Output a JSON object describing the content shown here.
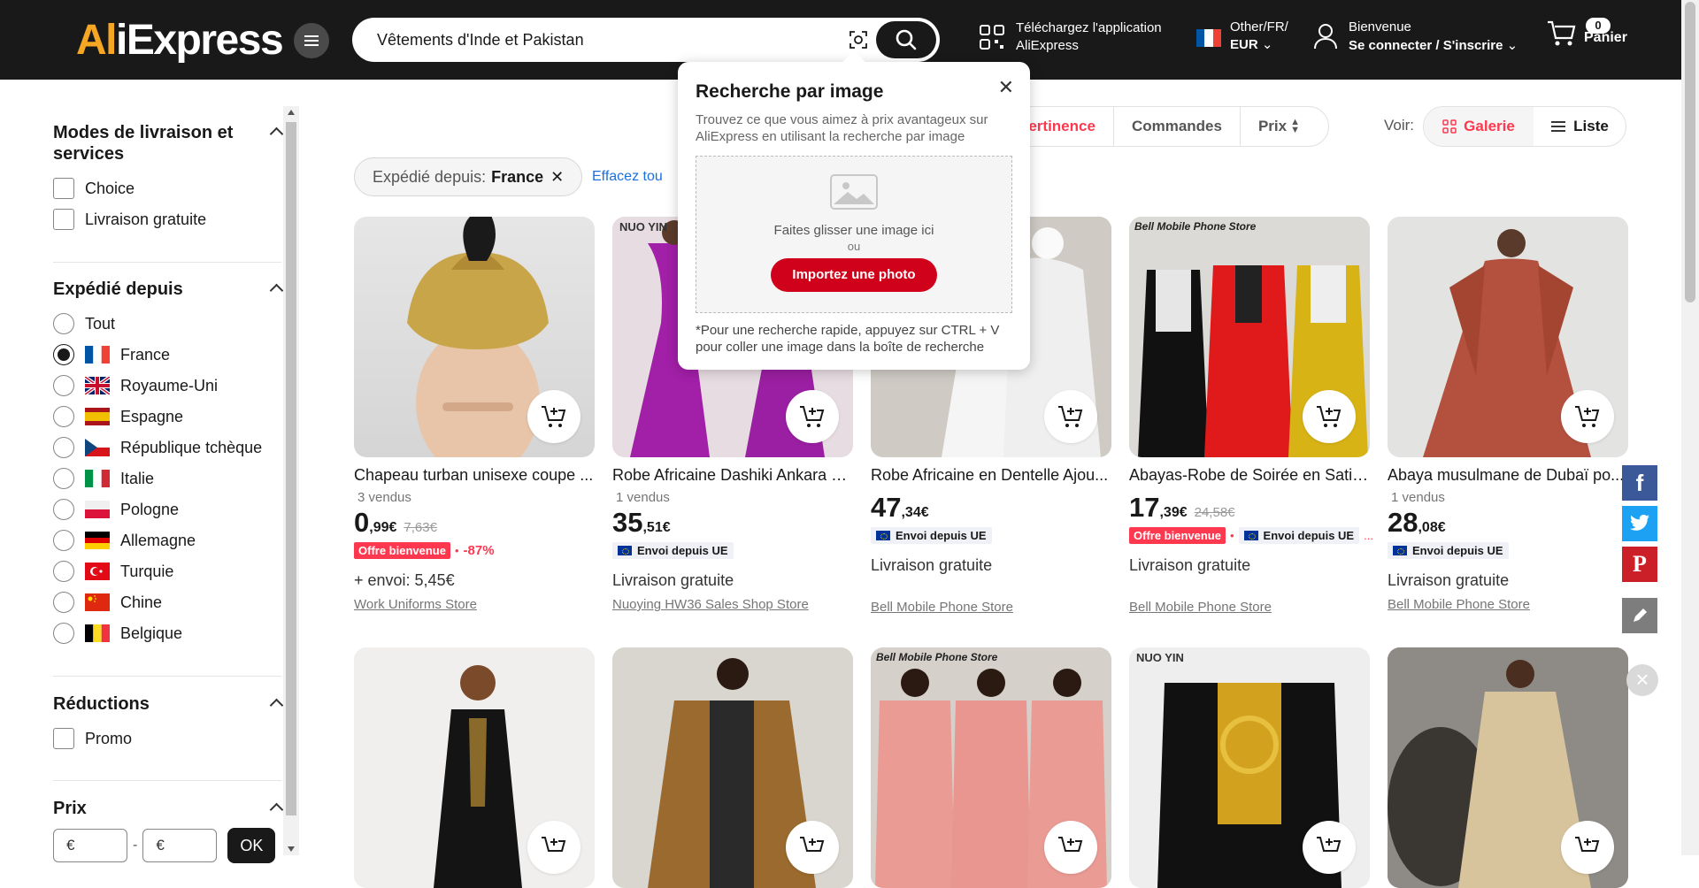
{
  "header": {
    "logo_left": "Al",
    "logo_right": "iExpress",
    "search_value": "Vêtements d'Inde et Pakistan",
    "app_download_line1": "Téléchargez l'application",
    "app_download_line2": "AliExpress",
    "locale_line1": "Other/FR/",
    "locale_line2": "EUR",
    "user_line1": "Bienvenue",
    "user_line2": "Se connecter / S'inscrire",
    "cart_count": "0",
    "cart_label": "Panier",
    "colors": {
      "bar": "#191919",
      "accent": "#f5a623"
    }
  },
  "sidebar": {
    "delivery": {
      "title": "Modes de livraison et services",
      "options": [
        "Choice",
        "Livraison gratuite"
      ]
    },
    "ship_from": {
      "title": "Expédié depuis",
      "options": [
        "Tout",
        "France",
        "Royaume-Uni",
        "Espagne",
        "République tchèque",
        "Italie",
        "Pologne",
        "Allemagne",
        "Turquie",
        "Chine",
        "Belgique"
      ],
      "selected": "France"
    },
    "reductions": {
      "title": "Réductions",
      "options": [
        "Promo"
      ]
    },
    "price": {
      "title": "Prix",
      "min_placeholder": "€",
      "max_placeholder": "€",
      "separator": "-",
      "ok_label": "OK"
    }
  },
  "sort": {
    "options": [
      "Pertinence",
      "Commandes",
      "Prix"
    ],
    "active": "Pertinence",
    "view_label": "Voir:",
    "view_gallery": "Galerie",
    "view_list": "Liste"
  },
  "filters": {
    "chip_label": "Expédié depuis:",
    "chip_value": "France",
    "clear_label": "Effacez tou"
  },
  "popup": {
    "title": "Recherche par image",
    "description": "Trouvez ce que vous aimez à prix avantageux sur AliExpress en utilisant la recherche par image",
    "drop_text": "Faites glisser une image ici",
    "or_text": "ou",
    "upload_label": "Importez une photo",
    "hint": "*Pour une recherche rapide, appuyez sur CTRL + V pour coller une image dans la boîte de recherche"
  },
  "products": [
    {
      "title": "Chapeau turban unisexe coupe ...",
      "sold": "3 vendus",
      "price_int": "0",
      "price_dec": ",99€",
      "old_price": "7,63€",
      "badge": "Offre bienvenue",
      "discount": "-87%",
      "shipping": "+ envoi: 5,45€",
      "store": "Work Uniforms Store"
    },
    {
      "title": "Robe Africaine Dashiki Ankara à...",
      "sold": "1 vendus",
      "price_int": "35",
      "price_dec": ",51€",
      "eu_label": "Envoi depuis UE",
      "shipping": "Livraison gratuite",
      "store": "Nuoying HW36 Sales Shop Store"
    },
    {
      "title": "Robe Africaine en Dentelle Ajou...",
      "price_int": "47",
      "price_dec": ",34€",
      "eu_label": "Envoi depuis UE",
      "shipping": "Livraison gratuite",
      "store": "Bell Mobile Phone Store"
    },
    {
      "title": "Abayas-Robe de Soirée en Satin...",
      "price_int": "17",
      "price_dec": ",39€",
      "old_price": "24,58€",
      "badge": "Offre bienvenue",
      "eu_label": "Envoi depuis UE",
      "more": "...",
      "shipping": "Livraison gratuite",
      "store": "Bell Mobile Phone Store"
    },
    {
      "title": "Abaya musulmane de Dubaï po...",
      "sold": "1 vendus",
      "price_int": "28",
      "price_dec": ",08€",
      "eu_label": "Envoi depuis UE",
      "shipping": "Livraison gratuite",
      "store": "Bell Mobile Phone Store"
    }
  ],
  "image_watermarks": {
    "nuo_yin": "NUO YIN",
    "bell": "Bell Mobile Phone Store"
  },
  "social": [
    "facebook-icon",
    "twitter-icon",
    "pinterest-icon",
    "edit-icon"
  ]
}
